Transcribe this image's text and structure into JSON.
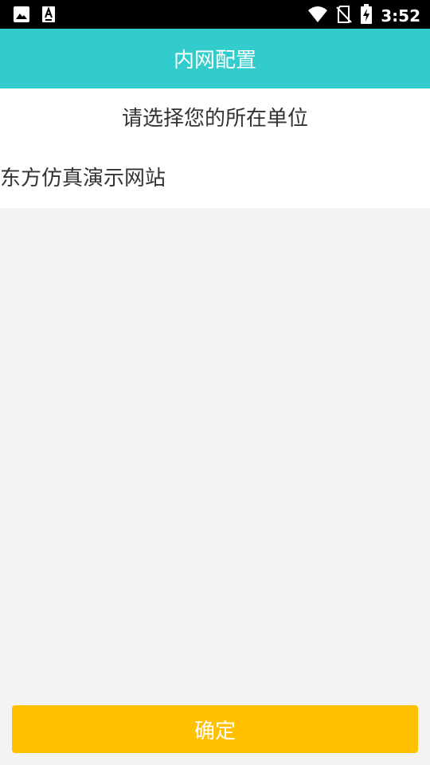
{
  "status_bar": {
    "time": "3:52",
    "icons": [
      "image-icon",
      "font-icon",
      "wifi-icon",
      "no-sim-icon",
      "battery-charging-icon"
    ]
  },
  "app_bar": {
    "title": "内网配置"
  },
  "main": {
    "prompt": "请选择您的所在单位",
    "units": [
      {
        "label": "东方仿真演示网站"
      }
    ]
  },
  "footer": {
    "confirm_label": "确定"
  },
  "colors": {
    "app_bar_bg": "#33cccc",
    "button_bg": "#ffc000",
    "page_bg": "#f3f3f3",
    "text": "#333333"
  }
}
